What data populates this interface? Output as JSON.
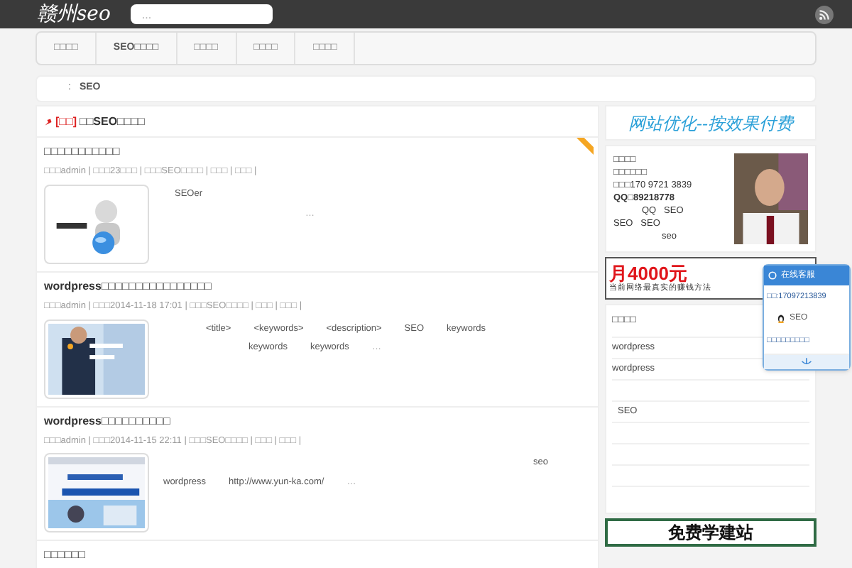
{
  "header": {
    "logo": "赣州seo",
    "search": {
      "placeholder": "..."
    }
  },
  "nav": [
    {
      "label": "□□□□",
      "selected": false
    },
    {
      "label": "SEO□□□□",
      "selected": false
    },
    {
      "label": "□□□□",
      "selected": false
    },
    {
      "label": "□□□□",
      "selected": false
    },
    {
      "label": "□□□□",
      "selected": false
    }
  ],
  "breadcrumb": [
    ":",
    "SEO"
  ],
  "category": {
    "tag": "[□□]",
    "title": "□□SEO□□□□"
  },
  "posts": [
    {
      "title": "□□□□□□□□□□□",
      "meta": "□□□admin | □□□23□□□ | □□□SEO□□□□ | □□□ | □□□ |",
      "excerpt": [
        [
          "SEOer"
        ],
        [
          "…"
        ]
      ],
      "featured": true
    },
    {
      "title": "wordpress□□□□□□□□□□□□□□□□",
      "meta": "□□□admin | □□□2014-11-18 17:01 | □□□SEO□□□□ | □□□ | □□□ |",
      "excerpt": [
        [
          "<title>",
          "<keywords>",
          "<description>",
          "SEO",
          "keywords"
        ],
        [
          "keywords",
          "keywords",
          "…"
        ]
      ],
      "featured": false
    },
    {
      "title": "wordpress□□□□□□□□□□",
      "meta": "□□□admin | □□□2014-11-15 22:11 | □□□SEO□□□□ | □□□ | □□□ |",
      "excerpt": [
        [
          "seo"
        ],
        [
          "wordpress",
          "http://www.yun-ka.com/",
          "…"
        ]
      ],
      "featured": false
    },
    {
      "title": "□□□□□□",
      "featured": false
    }
  ],
  "sidebar": {
    "banner_top": "网站优化--按效果付费",
    "profile": {
      "lines": [
        "□□□□",
        "□□□□□□",
        "□□□170 9721 3839",
        "QQ□89218778",
        "QQ   SEO",
        "SEO   SEO",
        "seo"
      ]
    },
    "banner_mid": {
      "big": "月4000元",
      "small": "当前网络最真实的赚钱方法"
    },
    "widget": {
      "title": "□□□□",
      "items": [
        {
          "text": "wordpress",
          "gap_before": false
        },
        {
          "text": "wordpress",
          "gap_before": false
        },
        {
          "text": "SEO",
          "gap_before": true
        }
      ]
    },
    "banner_bottom": "免费学建站"
  },
  "chat": {
    "title": "在线客服",
    "phone": "□□:17097213839",
    "qq": "SEO",
    "link": "□□□□□□□□□"
  }
}
